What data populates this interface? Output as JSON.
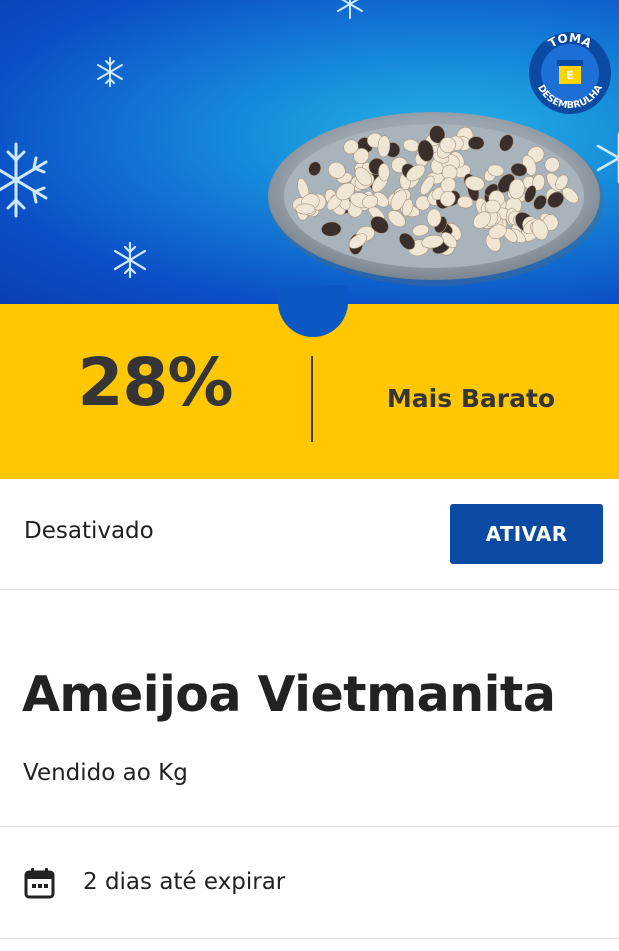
{
  "badge": {
    "line1": "TOMA",
    "middle": "E",
    "line2": "DESEMBRULHA"
  },
  "product_image": {
    "description_icon": "clams-plate-image"
  },
  "discount": {
    "percent": "28%",
    "label": "Mais Barato"
  },
  "status": {
    "text": "Desativado",
    "button_label": "ATIVAR"
  },
  "product": {
    "title": "Ameijoa Vietmanita",
    "subtitle": "Vendido ao Kg"
  },
  "expiry": {
    "icon": "calendar-icon",
    "text": "2 dias até expirar"
  },
  "colors": {
    "banner_blue": "#0b58c4",
    "discount_yellow": "#ffc700",
    "button_blue": "#0a4aa3"
  }
}
